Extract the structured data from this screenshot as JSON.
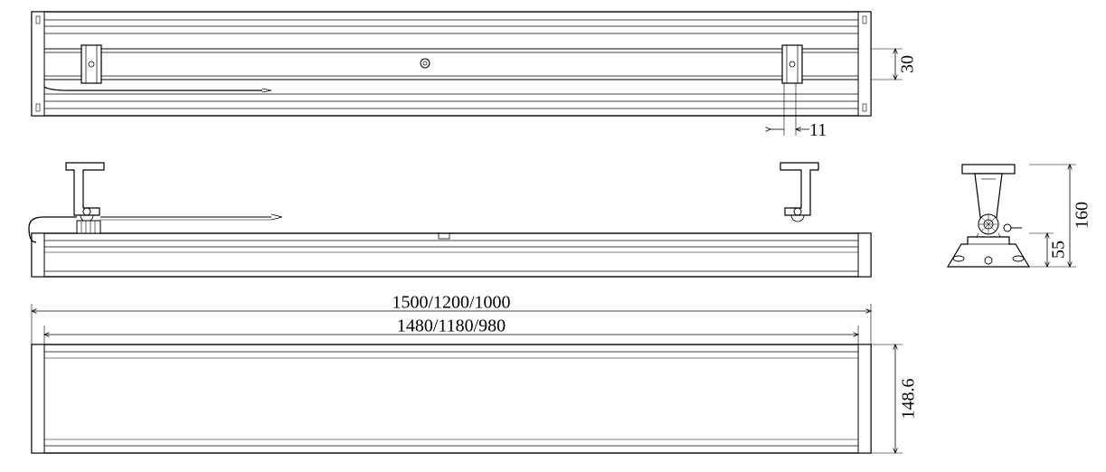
{
  "dimensions": {
    "top_slot_width": "30",
    "top_tab": "11",
    "outer_lengths": "1500/1200/1000",
    "inner_lengths": "1480/1180/980",
    "bottom_height": "148.6",
    "bracket_total_height": "160",
    "bracket_body_height": "55"
  }
}
